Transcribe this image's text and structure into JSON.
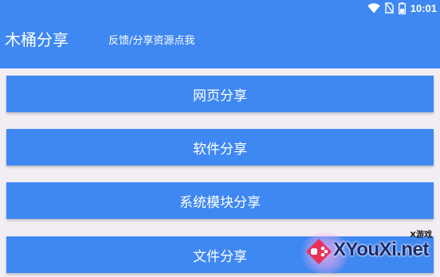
{
  "status_bar": {
    "time": "10:01",
    "icons": [
      "wifi-icon",
      "no-sim-icon",
      "battery-icon"
    ]
  },
  "header": {
    "title": "木桶分享",
    "feedback_link": "反馈/分享资源点我"
  },
  "menu": {
    "items": [
      {
        "label": "网页分享"
      },
      {
        "label": "软件分享"
      },
      {
        "label": "系统模块分享"
      },
      {
        "label": "文件分享"
      }
    ]
  },
  "watermark": {
    "small_text": "X游戏",
    "text": "XYouXi.net"
  },
  "colors": {
    "primary": "#3f88f2",
    "background": "#f1edf3",
    "text_on_primary": "#ffffff"
  }
}
